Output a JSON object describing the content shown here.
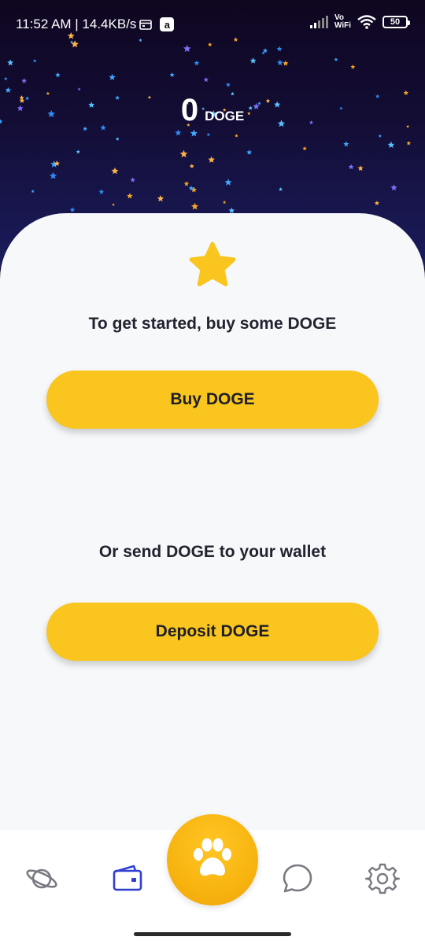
{
  "status_bar": {
    "time_speed": "11:52 AM | 14.4KB/s",
    "app_badge": "a",
    "vowifi_top": "Vo",
    "vowifi_bottom": "WiFi",
    "battery": "50"
  },
  "balance": {
    "amount": "0",
    "unit": "DOGE"
  },
  "main": {
    "star_icon": "star-icon",
    "get_started_text": "To get started, buy some DOGE",
    "buy_button_label": "Buy DOGE",
    "send_text": "Or send DOGE to your wallet",
    "deposit_button_label": "Deposit DOGE"
  },
  "bottom_nav": {
    "items": [
      {
        "icon": "planet-icon",
        "active": false
      },
      {
        "icon": "wallet-icon",
        "active": true
      },
      {
        "icon": "paw-icon",
        "active": false
      },
      {
        "icon": "chat-icon",
        "active": false
      },
      {
        "icon": "gear-icon",
        "active": false
      }
    ]
  },
  "colors": {
    "accent_yellow": "#f9c51e",
    "fab_orange": "#f8b40f",
    "active_nav": "#2f3fd0",
    "inactive_nav": "#7a7a82",
    "card_bg": "#f7f8fa",
    "sky_top": "#0f0620",
    "sky_bottom": "#1a1c5c"
  }
}
